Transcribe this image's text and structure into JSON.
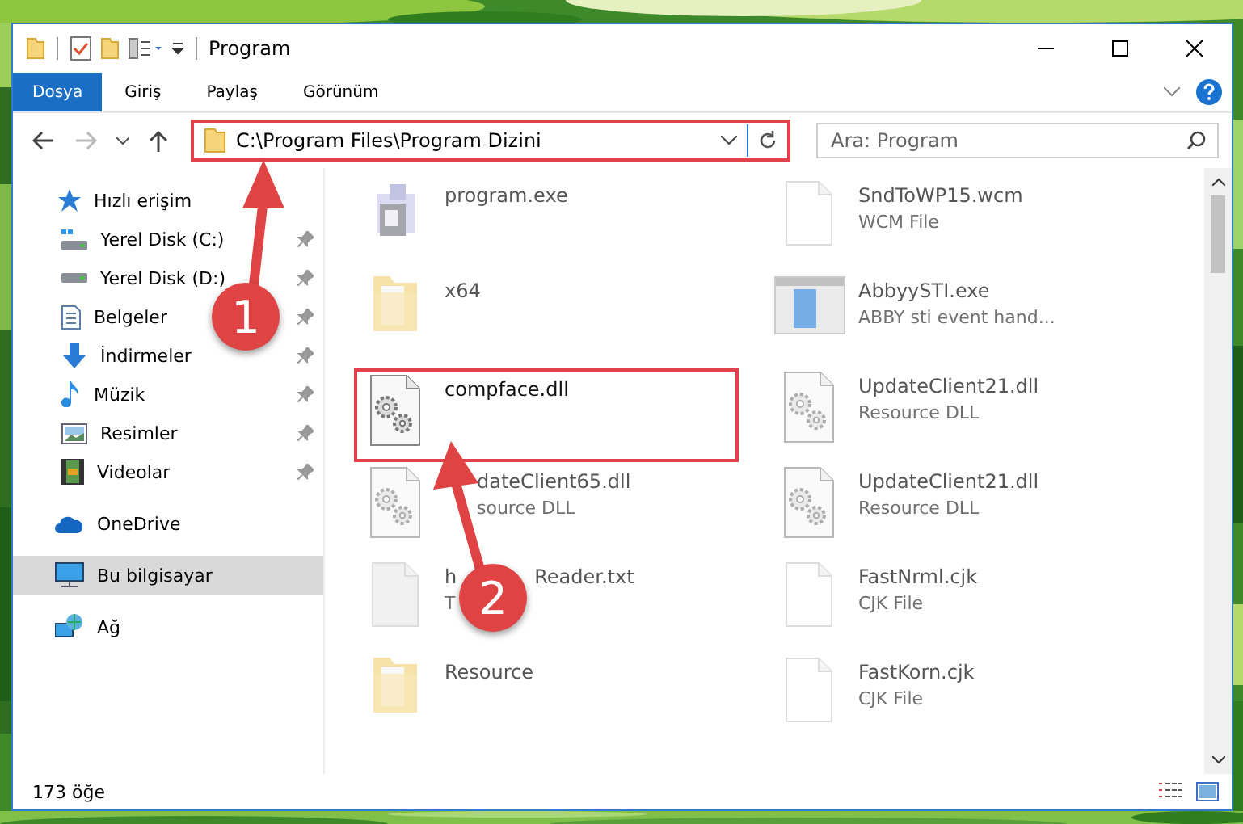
{
  "window": {
    "title": "Program"
  },
  "ribbon_tabs": [
    {
      "label": "Dosya",
      "selected": true
    },
    {
      "label": "Giriş",
      "selected": false
    },
    {
      "label": "Paylaş",
      "selected": false
    },
    {
      "label": "Görünüm",
      "selected": false
    }
  ],
  "address": {
    "path": "C:\\Program Files\\Program Dizini",
    "highlighted": true
  },
  "search": {
    "placeholder": "Ara: Program"
  },
  "sidebar": {
    "items": [
      {
        "label": "Hızlı erişim",
        "kind": "star",
        "selected": false,
        "children": [
          {
            "label": "Yerel Disk (C:)",
            "kind": "drive-c",
            "pinned": true,
            "selected": false
          },
          {
            "label": "Yerel Disk (D:)",
            "kind": "drive",
            "pinned": true,
            "selected": false
          },
          {
            "label": "Belgeler",
            "kind": "document",
            "pinned": true,
            "selected": false
          },
          {
            "label": "İndirmeler",
            "kind": "download",
            "pinned": true,
            "selected": false
          },
          {
            "label": "Müzik",
            "kind": "music",
            "pinned": true,
            "selected": false
          },
          {
            "label": "Resimler",
            "kind": "pictures",
            "pinned": true,
            "selected": false
          },
          {
            "label": "Videolar",
            "kind": "video",
            "pinned": true,
            "selected": false
          }
        ]
      },
      {
        "label": "OneDrive",
        "kind": "cloud",
        "selected": false
      },
      {
        "label": "Bu bilgisayar",
        "kind": "computer",
        "selected": true
      },
      {
        "label": "Ağ",
        "kind": "network",
        "selected": false
      }
    ]
  },
  "files": [
    {
      "name": "program.exe",
      "kind": "exe",
      "highlighted": false
    },
    {
      "name": "SndToWP15.wcm",
      "type": "WCM File",
      "kind": "blank",
      "highlighted": false
    },
    {
      "name": "x64",
      "kind": "folder",
      "highlighted": false
    },
    {
      "name": "AbbyySTI.exe",
      "type": "ABBY sti event hand...",
      "kind": "app",
      "highlighted": false
    },
    {
      "name": "compface.dll",
      "kind": "dll",
      "highlighted": true
    },
    {
      "name": "UpdateClient21.dll",
      "type": "Resource DLL",
      "kind": "dll",
      "highlighted": false
    },
    {
      "name": "dateClient65.dll",
      "type": "source DLL",
      "kind": "dll",
      "highlighted": false,
      "covered": true
    },
    {
      "name": "UpdateClient21.dll",
      "type": "Resource DLL",
      "kind": "dll",
      "highlighted": false
    },
    {
      "name": "Reader.txt",
      "name_start": "h",
      "type": "T",
      "kind": "text",
      "highlighted": false,
      "covered": true
    },
    {
      "name": "FastNrml.cjk",
      "type": "CJK File",
      "kind": "blank",
      "highlighted": false
    },
    {
      "name": "Resource",
      "kind": "folder",
      "highlighted": false
    },
    {
      "name": "FastKorn.cjk",
      "type": "CJK File",
      "kind": "blank",
      "highlighted": false
    }
  ],
  "callouts": [
    {
      "number": "1"
    },
    {
      "number": "2"
    }
  ],
  "status_bar": {
    "count": "173 öğe"
  }
}
